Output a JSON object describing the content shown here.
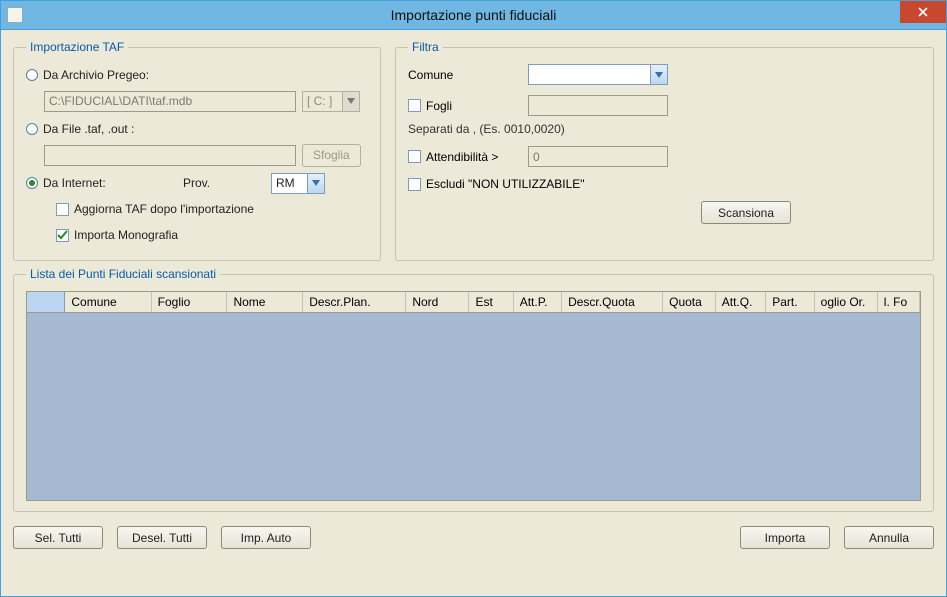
{
  "window": {
    "title": "Importazione punti fiduciali"
  },
  "import_taf": {
    "legend": "Importazione TAF",
    "radio_pregeo": "Da Archivio Pregeo:",
    "pregeo_path": "C:\\FIDUCIAL\\DATI\\taf.mdb",
    "drive_label": "[ C: ]",
    "radio_file": "Da File .taf, .out :",
    "file_path": "",
    "browse": "Sfoglia",
    "radio_internet": "Da Internet:",
    "prov_label": "Prov.",
    "prov_value": "RM",
    "chk_aggiorna": "Aggiorna TAF dopo l'importazione",
    "chk_monografia": "Importa Monografia"
  },
  "filter": {
    "legend": "Filtra",
    "comune_label": "Comune",
    "comune_value": "",
    "fogli_label": "Fogli",
    "fogli_value": "",
    "fogli_hint": "Separati da , (Es. 0010,0020)",
    "attend_label": "Attendibilità  >",
    "attend_value": "0",
    "escludi_label": "Escludi \"NON UTILIZZABILE\"",
    "scan_button": "Scansiona"
  },
  "list": {
    "legend": "Lista dei Punti Fiduciali scansionati",
    "columns": [
      "",
      "Comune",
      "Foglio",
      "Nome",
      "Descr.Plan.",
      "Nord",
      "Est",
      "Att.P.",
      "Descr.Quota",
      "Quota",
      "Att.Q.",
      "Part.",
      "oglio Or.",
      "l. Fo"
    ]
  },
  "bottom": {
    "sel_tutti": "Sel. Tutti",
    "desel_tutti": "Desel. Tutti",
    "imp_auto": "Imp. Auto",
    "importa": "Importa",
    "annulla": "Annulla"
  }
}
